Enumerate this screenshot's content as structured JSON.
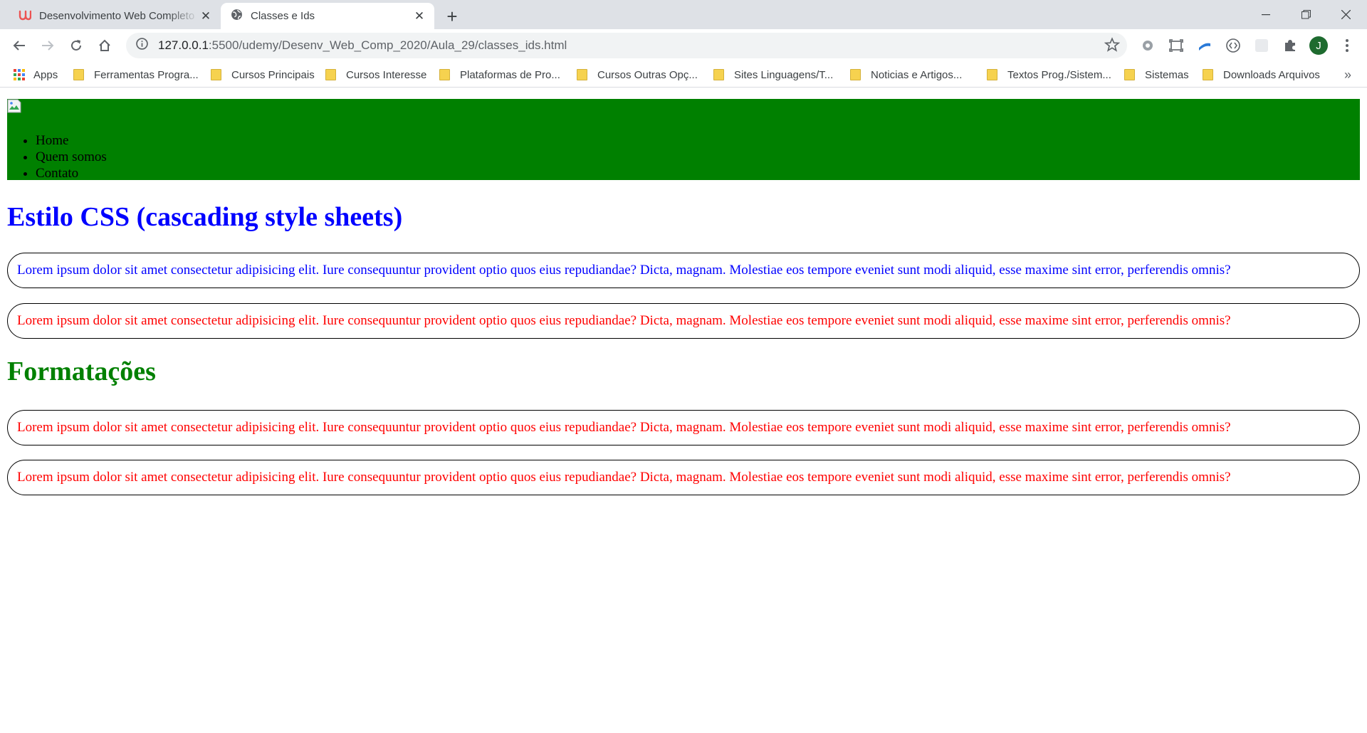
{
  "browser": {
    "tabs": [
      {
        "title": "Desenvolvimento Web Completo",
        "favicon": "udemy-icon",
        "active": false
      },
      {
        "title": "Classes e Ids",
        "favicon": "globe-icon",
        "active": true
      }
    ],
    "url_host": "127.0.0.1",
    "url_path": ":5500/udemy/Desenv_Web_Comp_2020/Aula_29/classes_ids.html",
    "profile_initial": "J",
    "bookmarks": [
      "Apps",
      "Ferramentas Progra...",
      "Cursos Principais",
      "Cursos Interesse",
      "Plataformas de Pro...",
      "Cursos Outras Opç...",
      "Sites Linguagens/T...",
      "Noticias e Artigos...",
      "Textos Prog./Sistem...",
      "Sistemas",
      "Downloads Arquivos"
    ]
  },
  "page": {
    "header_color": "#008000",
    "nav": [
      "Home",
      "Quem somos",
      "Contato"
    ],
    "heading1": "Estilo CSS (cascading style sheets)",
    "heading1_color": "#0000ff",
    "heading2": "Formatações",
    "heading2_color": "#008000",
    "paragraph_text": "Lorem ipsum dolor sit amet consectetur adipisicing elit. Iure consequuntur provident optio quos eius repudiandae? Dicta, magnam. Molestiae eos tempore eveniet sunt modi aliquid, esse maxime sint error, perferendis omnis?",
    "paragraphs": [
      {
        "text": "Lorem ipsum dolor sit amet consectetur adipisicing elit. Iure consequuntur provident optio quos eius repudiandae? Dicta, magnam. Molestiae eos tempore eveniet sunt modi aliquid, esse maxime sint error, perferendis omnis?",
        "color": "#0000ff"
      },
      {
        "text": "Lorem ipsum dolor sit amet consectetur adipisicing elit. Iure consequuntur provident optio quos eius repudiandae? Dicta, magnam. Molestiae eos tempore eveniet sunt modi aliquid, esse maxime sint error, perferendis omnis?",
        "color": "#ff0000"
      },
      {
        "text": "Lorem ipsum dolor sit amet consectetur adipisicing elit. Iure consequuntur provident optio quos eius repudiandae? Dicta, magnam. Molestiae eos tempore eveniet sunt modi aliquid, esse maxime sint error, perferendis omnis?",
        "color": "#ff0000"
      },
      {
        "text": "Lorem ipsum dolor sit amet consectetur adipisicing elit. Iure consequuntur provident optio quos eius repudiandae? Dicta, magnam. Molestiae eos tempore eveniet sunt modi aliquid, esse maxime sint error, perferendis omnis?",
        "color": "#ff0000"
      }
    ]
  }
}
